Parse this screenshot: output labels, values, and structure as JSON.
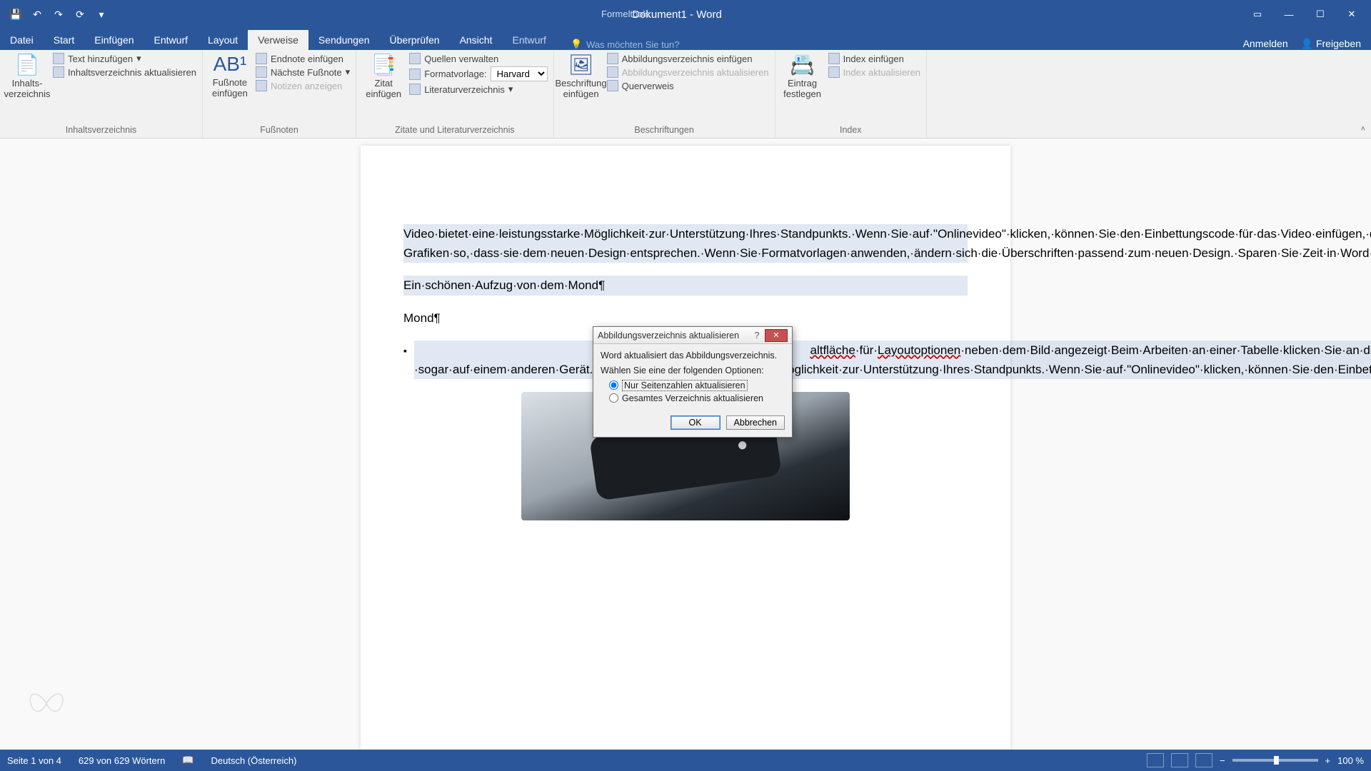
{
  "titlebar": {
    "context_tool": "Formeltools",
    "doc_title": "Dokument1 - Word"
  },
  "qat": {
    "save": "💾",
    "undo": "↶",
    "redo": "↷",
    "touch": "⟳"
  },
  "tabs": {
    "datei": "Datei",
    "start": "Start",
    "einfuegen": "Einfügen",
    "entwurf": "Entwurf",
    "layout": "Layout",
    "verweise": "Verweise",
    "sendungen": "Sendungen",
    "ueberpruefen": "Überprüfen",
    "ansicht": "Ansicht",
    "entwurf2": "Entwurf",
    "tellme": "Was möchten Sie tun?"
  },
  "title_right": {
    "anmelden": "Anmelden",
    "freigeben": "Freigeben"
  },
  "ribbon": {
    "g1": {
      "toc": "Inhalts-\nverzeichnis",
      "add_text": "Text hinzufügen",
      "update_toc": "Inhaltsverzeichnis aktualisieren",
      "label": "Inhaltsverzeichnis"
    },
    "g2": {
      "insert_fn": "Fußnote\neinfügen",
      "insert_en": "Endnote einfügen",
      "next_fn": "Nächste Fußnote",
      "show_notes": "Notizen anzeigen",
      "label": "Fußnoten"
    },
    "g3": {
      "insert_cit": "Zitat\neinfügen",
      "manage": "Quellen verwalten",
      "style_label": "Formatvorlage:",
      "style_value": "Harvard",
      "bib": "Literaturverzeichnis",
      "label": "Zitate und Literaturverzeichnis"
    },
    "g4": {
      "caption": "Beschriftung\neinfügen",
      "fig_list": "Abbildungsverzeichnis einfügen",
      "fig_update": "Abbildungsverzeichnis aktualisieren",
      "crossref": "Querverweis",
      "label": "Beschriftungen"
    },
    "g5": {
      "entry": "Eintrag\nfestlegen",
      "insert_idx": "Index einfügen",
      "update_idx": "Index aktualisieren",
      "label": "Index"
    }
  },
  "doc": {
    "p1": "Video·bietet·eine·leistungsstarke·Möglichkeit·zur·Unterstützung·Ihres·Standpunkts.·Wenn·Sie·auf·\"Onlinevideo\"·klicken,·können·Sie·den·Einbettungscode·für·das·Video·einfügen,·das·hinzugefügt·werden·soll.·Sie·können·auch·ein·Stichwort·eingeben,·um·online·nach·dem·Videoclip·zu·suchen,·der·optimal·zu·Ihrem·Dokument·passt.·Damit·Ihr·Dokument·ein·professionelles·Aussehen·erhält,·stellt·Word·einander·ergänzende·Designs·für·Kopfzeile,·Fußzeile,·Deckblatt·und·Textfelder·zur·Verfügung.·Beispielsweise·können·Sie·ein·passendes·Deckblatt·mit·Kopfzeile·und·Randleiste·hinzufügen.·Klicken·Sie·auf·\"Einfügen\",·und·wählen·Sie·dann·die·gewünschten·Elemente·aus·den·verschiedenen·Katalogen·aus.·Designs·und·Formatvorlagen·helfen·auch·dabei,·die·Elemente·Ihres·Dokuments·aufeinander·abzustimmen.·Wenn·Sie·auf·\"Design\"·klicken·und·ein·neues·Design·auswählen,·ändern·sich·die·Grafiken,·Diagramme·und·SmartArt-Grafiken·so,·dass·sie·dem·neuen·Design·entsprechen.·Wenn·Sie·Formatvorlagen·anwenden,·ändern·sich·die·Überschriften·passend·zum·neuen·Design.·Sparen·Sie·Zeit·in·Word·dank·neuer·Schaltflächen,·die·angezeigt·werden,·wo·Sie·sie·benötigen.¶",
    "p2": "Ein·schönen·Aufzug·von·dem·Mond¶",
    "p3": "Mond¶",
    "bullet_w1": "altfläche",
    "bullet_mid": "·für·",
    "bullet_w2": "Layoutoptionen",
    "bullet_rest": "·neben·dem·Bild·angezeigt·Beim·Arbeiten·an·einer·Tabelle·klicken·Sie·an·die·Position,·an·der·Sie·eine·Zeile·oder·Spalte·hinzufügen·möchten,·und·klicken·Sie·dann·auf·das·Pluszeichen.·Auch·das·Lesen·ist·bequemer·in·der·neuen·Leseansicht.·Sie·können·Teile·des·Dokuments·reduzieren·und·sich·auf·den·gewünschten·Text·konzentrieren.·Wenn·Sie·vor·dem·Ende·zu·lesen·aufhören·müssen,·merkt·sich·Word·die·Stelle,·bis·zu·der·Sie·gelangt·sind·–·sogar·auf·einem·anderen·Gerät.·Video·bietet·eine·leistungsstarke·Möglichkeit·zur·Unterstützung·Ihres·Standpunkts.·Wenn·Sie·auf·\"Onlinevideo\"·klicken,·können·Sie·den·Einbettungscode·für·das·Video·einfügen,·das·hinzugefügt·werden·soll.·Sie·können·auch·ein·Stichwort·eingeben,·um·online·nach·dem·Videoclip·zu·suchen,·der·optimal·zu·Ihrem·Dokument·passt.·Damit·Ihr·Dokument·ein·professionelles·Aussehen·erhält,·stellt·Word·einander·ergänzende·Designs·für·Kopfzeile,·Fußzeile,·Deckblatt·und·Textfelder·zur·Verfügung.·Beispielsweise·können·Sie·ein·passendes·Deckblatt·mit·Kopfzeile·und·Randleiste·hinzufügen.·"
  },
  "dialog": {
    "title": "Abbildungsverzeichnis aktualisieren",
    "msg1": "Word aktualisiert das Abbildungsverzeichnis.",
    "msg2": "Wählen Sie eine der folgenden Optionen:",
    "opt1": "Nur Seitenzahlen aktualisieren",
    "opt2": "Gesamtes Verzeichnis aktualisieren",
    "ok": "OK",
    "cancel": "Abbrechen"
  },
  "status": {
    "page": "Seite 1 von 4",
    "words": "629 von 629 Wörtern",
    "lang": "Deutsch (Österreich)",
    "zoom": "100 %"
  }
}
